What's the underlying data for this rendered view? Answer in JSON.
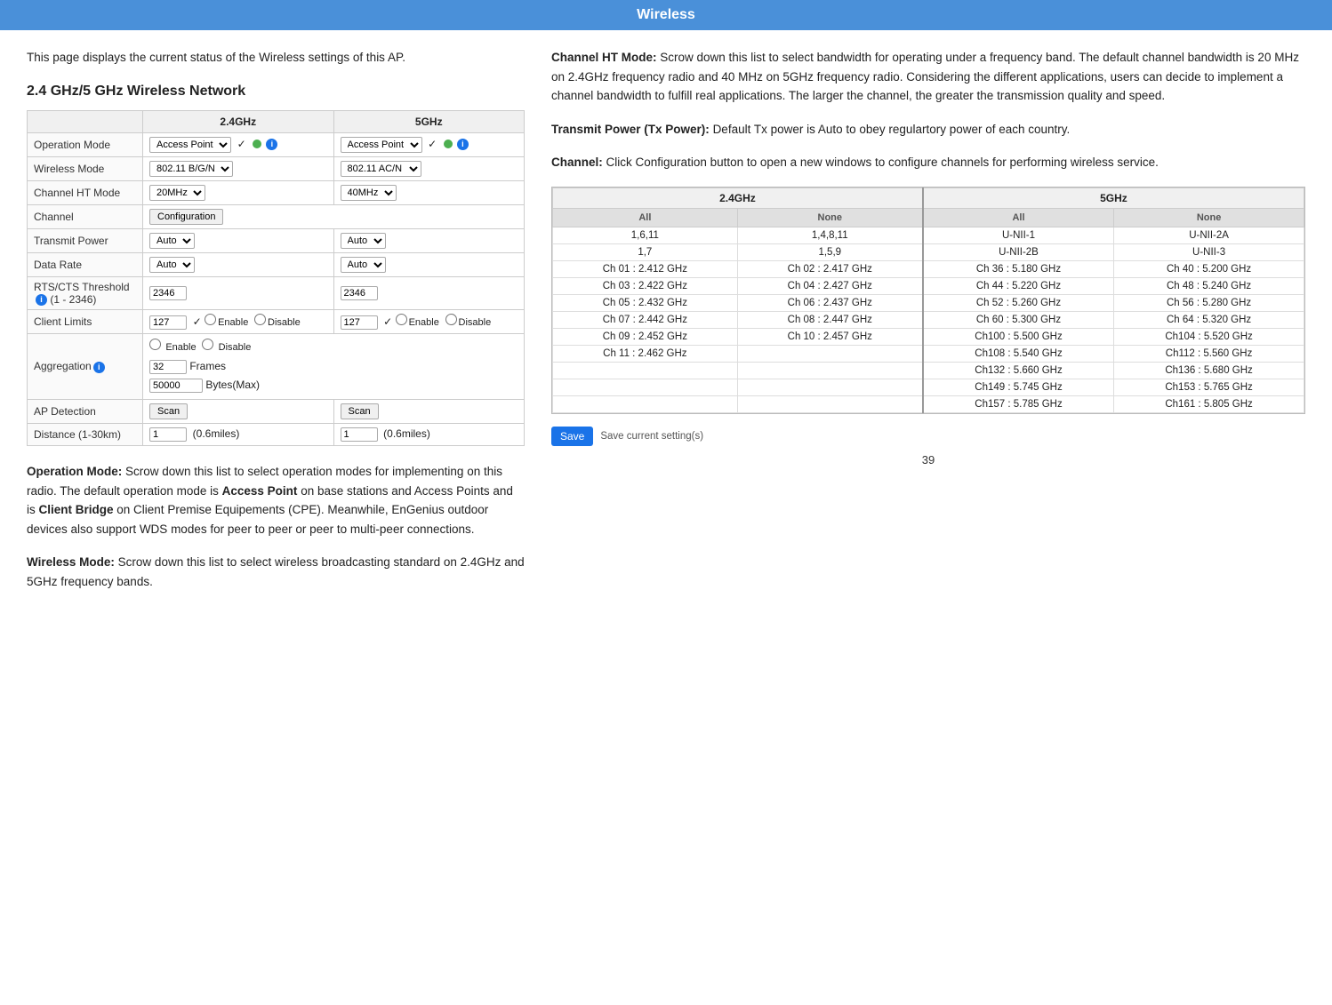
{
  "topbar": {
    "title": "Wireless"
  },
  "left": {
    "intro": "This page displays the current status of the Wireless settings of this AP.",
    "section_heading": "2.4 GHz/5 GHz Wireless Network",
    "table": {
      "col_24": "2.4GHz",
      "col_5": "5GHz",
      "rows": [
        {
          "label": "Operation Mode",
          "val_24": "Access Point",
          "val_5": "Access Point",
          "type": "select_green"
        },
        {
          "label": "Wireless Mode",
          "val_24": "802.11 B/G/N",
          "val_5": "802.11 AC/N",
          "type": "select"
        },
        {
          "label": "Channel HT Mode",
          "val_24": "20MHz",
          "val_5": "40MHz",
          "type": "select"
        },
        {
          "label": "Channel",
          "val_24": "Configuration",
          "val_5": "",
          "type": "config_button"
        },
        {
          "label": "Transmit Power",
          "val_24": "Auto",
          "val_5": "Auto",
          "type": "select"
        },
        {
          "label": "Data Rate",
          "val_24": "Auto",
          "val_5": "Auto",
          "type": "select"
        },
        {
          "label": "RTS/CTS Threshold (1 - 2346)",
          "val_24": "2346",
          "val_5": "2346",
          "has_info": true,
          "type": "input"
        },
        {
          "label": "Client Limits",
          "val_24": "127",
          "val_5": "127",
          "type": "client_limits"
        },
        {
          "label": "Aggregation",
          "has_info": true,
          "type": "aggregation"
        },
        {
          "label": "AP Detection",
          "type": "scan"
        },
        {
          "label": "Distance (1-30km)",
          "val_24": "1",
          "val_5": "1",
          "hint_24": "(0.6miles)",
          "hint_5": "(0.6miles)",
          "type": "distance"
        }
      ]
    },
    "descriptions": [
      {
        "term": "Operation Mode:",
        "text": " Scrow down this list to select operation modes for implementing on this radio. The default operation mode is ",
        "bold_inline": "Access Point",
        "text2": " on base stations and Access Points and is ",
        "bold_inline2": "Client Bridge",
        "text3": " on Client Premise Equipements (CPE). Meanwhile, EnGenius outdoor devices also support WDS modes for peer to peer or peer to multi-peer connections."
      },
      {
        "term": "Wireless Mode:",
        "text": " Scrow down this list to select wireless broadcasting standard on 2.4GHz and 5GHz frequency bands."
      }
    ]
  },
  "right": {
    "descriptions": [
      {
        "term": "Channel HT Mode:",
        "text": " Scrow down this list to select bandwidth for operating under a frequency band. The default channel bandwidth is 20 MHz on 2.4GHz frequency radio and 40 MHz on 5GHz frequency radio. Considering the different applications, users can decide to implement a channel bandwidth to fulfill real applications. The larger the channel, the greater the transmission quality and speed."
      },
      {
        "term": "Transmit Power (Tx Power):",
        "text": " Default Tx power is Auto to obey regulartory power of each country."
      },
      {
        "term": "Channel:",
        "text": " Click Configuration button to open a new windows to configure channels for performing wireless service."
      }
    ],
    "channel_table": {
      "header_24": "2.4GHz",
      "header_5": "5GHz",
      "col_headers_24": [
        "All",
        "None"
      ],
      "col_headers_5": [
        "All",
        "None"
      ],
      "rows_24": [
        [
          "1,6,11",
          "1,4,8,11"
        ],
        [
          "1,7",
          "1,5,9"
        ],
        [
          "Ch 01 : 2.412 GHz",
          "Ch 02 : 2.417 GHz"
        ],
        [
          "Ch 03 : 2.422 GHz",
          "Ch 04 : 2.427 GHz"
        ],
        [
          "Ch 05 : 2.432 GHz",
          "Ch 06 : 2.437 GHz"
        ],
        [
          "Ch 07 : 2.442 GHz",
          "Ch 08 : 2.447 GHz"
        ],
        [
          "Ch 09 : 2.452 GHz",
          "Ch 10 : 2.457 GHz"
        ],
        [
          "Ch 11 : 2.462 GHz",
          ""
        ]
      ],
      "rows_5": [
        [
          "U-NII-1",
          "U-NII-2A"
        ],
        [
          "U-NII-2B",
          "U-NII-3"
        ],
        [
          "Ch 36 : 5.180 GHz",
          "Ch 40 : 5.200 GHz"
        ],
        [
          "Ch 44 : 5.220 GHz",
          "Ch 48 : 5.240 GHz"
        ],
        [
          "Ch 52 : 5.260 GHz",
          "Ch 56 : 5.280 GHz"
        ],
        [
          "Ch 60 : 5.300 GHz",
          "Ch 64 : 5.320 GHz"
        ],
        [
          "Ch100 : 5.500 GHz",
          "Ch104 : 5.520 GHz"
        ],
        [
          "Ch108 : 5.540 GHz",
          "Ch112 : 5.560 GHz"
        ],
        [
          "Ch132 : 5.660 GHz",
          "Ch136 : 5.680 GHz"
        ],
        [
          "Ch149 : 5.745 GHz",
          "Ch153 : 5.765 GHz"
        ],
        [
          "Ch157 : 5.785 GHz",
          "Ch161 : 5.805 GHz"
        ]
      ]
    },
    "save_button": "Save",
    "save_hint": "Save current setting(s)"
  },
  "page_number": "39"
}
